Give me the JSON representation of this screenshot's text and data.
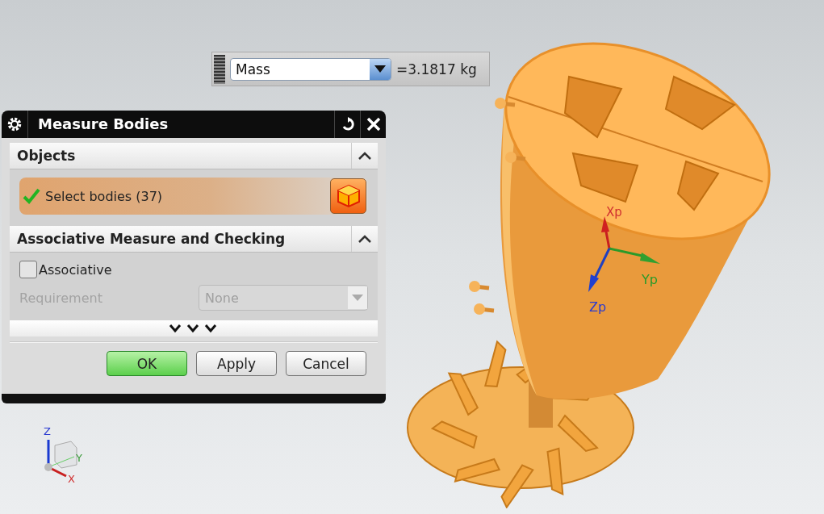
{
  "toolbar": {
    "quantity": {
      "value": "Mass"
    },
    "result": "=3.1817 kg"
  },
  "dialog": {
    "title": "Measure Bodies",
    "sections": [
      {
        "kind": "selection",
        "title": "Objects",
        "expanded": true,
        "label": "Select bodies (37)",
        "complete": true
      },
      {
        "kind": "options",
        "title": "Associative Measure and Checking",
        "expanded": true,
        "checkbox": {
          "label": "Associative",
          "checked": false
        },
        "field": {
          "label": "Requirement",
          "value": "None",
          "disabled": true
        }
      }
    ],
    "buttons": [
      {
        "label": "OK",
        "default": true
      },
      {
        "label": "Apply",
        "default": false
      },
      {
        "label": "Cancel",
        "default": false
      }
    ]
  },
  "viewport": {
    "work_csys": [
      "Xp",
      "Yp",
      "Zp"
    ],
    "view_triad": [
      "Z",
      "Y",
      "X"
    ]
  }
}
